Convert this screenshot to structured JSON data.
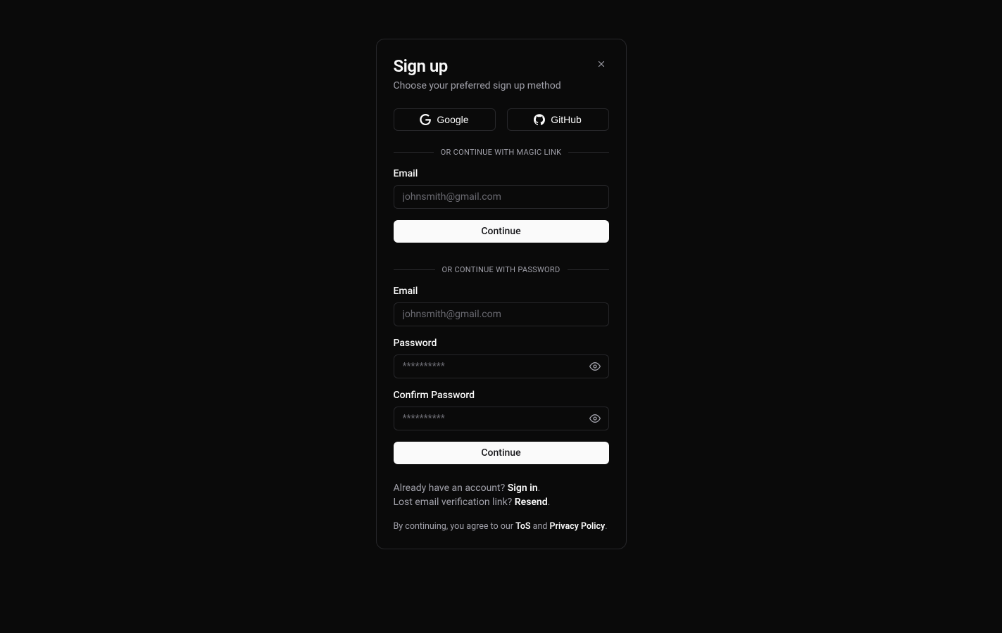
{
  "header": {
    "title": "Sign up",
    "subtitle": "Choose your preferred sign up method"
  },
  "oauth": {
    "google_label": "Google",
    "github_label": "GitHub"
  },
  "dividers": {
    "magic_link": "OR CONTINUE WITH MAGIC LINK",
    "password": "OR CONTINUE WITH PASSWORD"
  },
  "magic_link_form": {
    "email_label": "Email",
    "email_placeholder": "johnsmith@gmail.com",
    "continue_label": "Continue"
  },
  "password_form": {
    "email_label": "Email",
    "email_placeholder": "johnsmith@gmail.com",
    "password_label": "Password",
    "password_placeholder": "**********",
    "confirm_label": "Confirm Password",
    "confirm_placeholder": "**********",
    "continue_label": "Continue"
  },
  "footer": {
    "existing_account_prefix": "Already have an account? ",
    "sign_in_label": "Sign in",
    "lost_link_prefix": "Lost email verification link? ",
    "resend_label": "Resend",
    "legal_prefix": "By continuing, you agree to our ",
    "tos_label": "ToS",
    "legal_and": " and ",
    "privacy_label": "Privacy Policy",
    "period": "."
  }
}
